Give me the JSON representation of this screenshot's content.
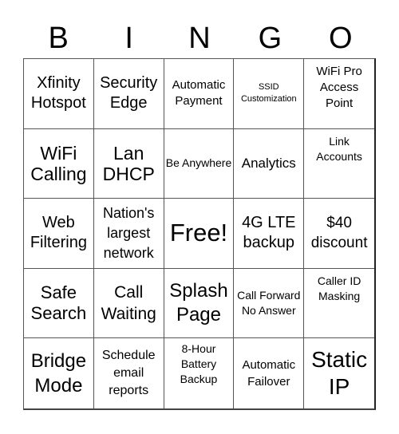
{
  "header": {
    "letters": [
      "B",
      "I",
      "N",
      "G",
      "O"
    ]
  },
  "board": {
    "rows": [
      [
        "Xfinity Hotspot",
        "Security Edge",
        "Automatic Payment",
        "SSID Customization",
        "WiFi Pro Access Point"
      ],
      [
        "WiFi Calling",
        "Lan DHCP",
        "Be Anywhere",
        "Analytics",
        "Link Accounts"
      ],
      [
        "Web Filtering",
        "Nation's largest network",
        "Free!",
        "4G LTE backup",
        "$40 discount"
      ],
      [
        "Safe Search",
        "Call Waiting",
        "Splash Page",
        "Call Forward No Answer",
        "Caller ID Masking"
      ],
      [
        "Bridge Mode",
        "Schedule email reports",
        "8-Hour Battery Backup",
        "Automatic Failover",
        "Static IP"
      ]
    ],
    "free_space": {
      "row": 2,
      "col": 2
    }
  },
  "colors": {
    "background": "#ffffff",
    "text": "#000000",
    "grid_line": "#555555"
  }
}
